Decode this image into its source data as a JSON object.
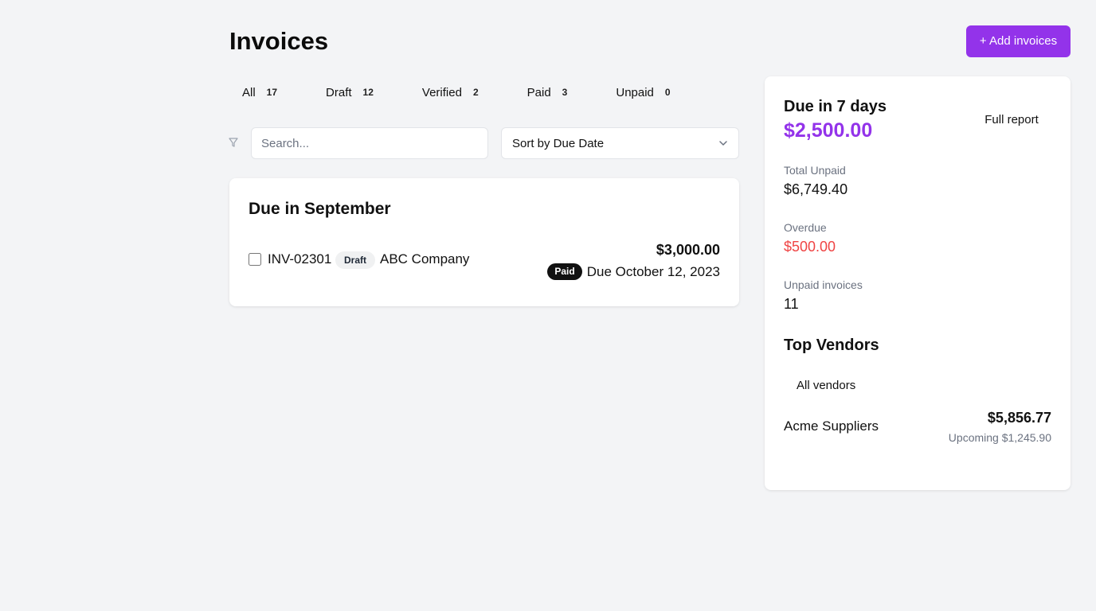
{
  "header": {
    "title": "Invoices",
    "add_button_label": "+ Add invoices"
  },
  "tabs": [
    {
      "label": "All",
      "count": "17"
    },
    {
      "label": "Draft",
      "count": "12"
    },
    {
      "label": "Verified",
      "count": "2"
    },
    {
      "label": "Paid",
      "count": "3"
    },
    {
      "label": "Unpaid",
      "count": "0"
    }
  ],
  "filters": {
    "filter_icon": "filter-icon",
    "search_placeholder": "Search...",
    "search_value": "",
    "sort_selected": "Sort by Due Date",
    "sort_icon": "chevron-down-icon"
  },
  "invoice_groups": [
    {
      "title": "Due in September",
      "invoices": [
        {
          "number": "INV-02301",
          "state_badge": "Draft",
          "company": "ABC Company",
          "amount": "$3,000.00",
          "payment_badge": "Paid",
          "due": "Due October 12, 2023"
        }
      ]
    }
  ],
  "summary": {
    "due_title": "Due in 7 days",
    "due_amount": "$2,500.00",
    "report_button_label": "Full report",
    "stats": [
      {
        "label": "Total Unpaid",
        "value": "$6,749.40"
      },
      {
        "label": "Overdue",
        "value": "$500.00"
      },
      {
        "label": "Unpaid invoices",
        "value": "11"
      }
    ]
  },
  "vendors": {
    "title": "Top Vendors",
    "all_button_label": "All vendors",
    "items": [
      {
        "name": "Acme Suppliers",
        "amount": "$5,856.77",
        "upcoming": "Upcoming $1,245.90"
      }
    ]
  },
  "colors": {
    "accent": "#9333ea",
    "overdue": "#ef4444",
    "background": "#f3f4f6",
    "muted_text": "#6b7280"
  }
}
